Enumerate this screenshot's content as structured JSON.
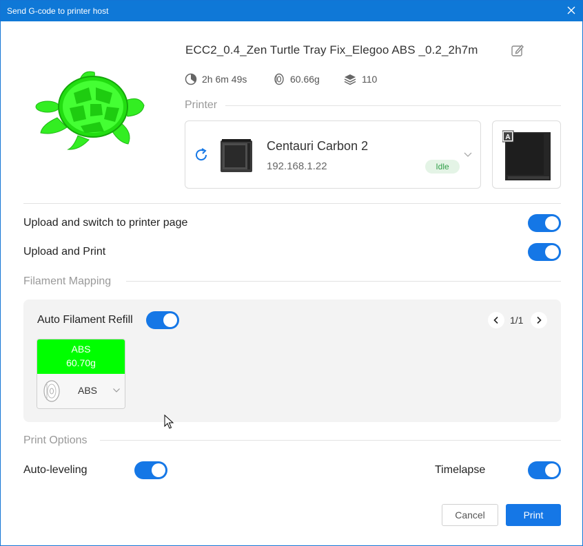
{
  "window": {
    "title": "Send G-code to printer host"
  },
  "file": {
    "name": "ECC2_0.4_Zen Turtle Tray Fix_Elegoo ABS _0.2_2h7m"
  },
  "stats": {
    "time": "2h 6m 49s",
    "weight": "60.66g",
    "layers": "110"
  },
  "printer_section": {
    "label": "Printer",
    "name": "Centauri Carbon 2",
    "ip": "192.168.1.22",
    "status": "Idle",
    "camera_badge": "A"
  },
  "options": {
    "upload_switch": {
      "label": "Upload and switch to printer page",
      "on": true
    },
    "upload_print": {
      "label": "Upload and Print",
      "on": true
    }
  },
  "filament_mapping": {
    "label": "Filament Mapping",
    "auto_refill": {
      "label": "Auto Filament Refill",
      "on": true
    },
    "page": "1/1",
    "slots": [
      {
        "material": "ABS",
        "weight": "60.70g",
        "color": "#00ff00",
        "mapped": "ABS"
      }
    ]
  },
  "print_options": {
    "label": "Print Options",
    "auto_leveling": {
      "label": "Auto-leveling",
      "on": true
    },
    "timelapse": {
      "label": "Timelapse",
      "on": true
    }
  },
  "buttons": {
    "cancel": "Cancel",
    "print": "Print"
  },
  "colors": {
    "accent": "#1577e6",
    "title_bar": "#0f78d7",
    "filament": "#00ff00",
    "idle_text": "#2f9e47"
  }
}
